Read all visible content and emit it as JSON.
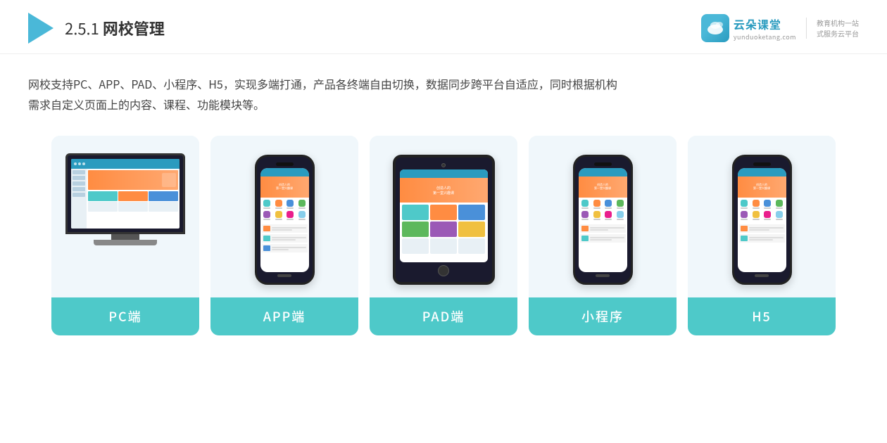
{
  "header": {
    "section_num": "2.5.1",
    "title_plain": "网校管理",
    "brand_name": "云朵课堂",
    "brand_pinyin": "yunduoketang.com",
    "brand_slogan_line1": "教育机构一站",
    "brand_slogan_line2": "式服务云平台"
  },
  "description": {
    "text_line1": "网校支持PC、APP、PAD、小程序、H5，实现多端打通，产品各终端自由切换，数据同步跨平台自适应，同时根据机构",
    "text_line2": "需求自定义页面上的内容、课程、功能模块等。"
  },
  "cards": [
    {
      "id": "pc",
      "label": "PC端"
    },
    {
      "id": "app",
      "label": "APP端"
    },
    {
      "id": "pad",
      "label": "PAD端"
    },
    {
      "id": "miniprogram",
      "label": "小程序"
    },
    {
      "id": "h5",
      "label": "H5"
    }
  ]
}
